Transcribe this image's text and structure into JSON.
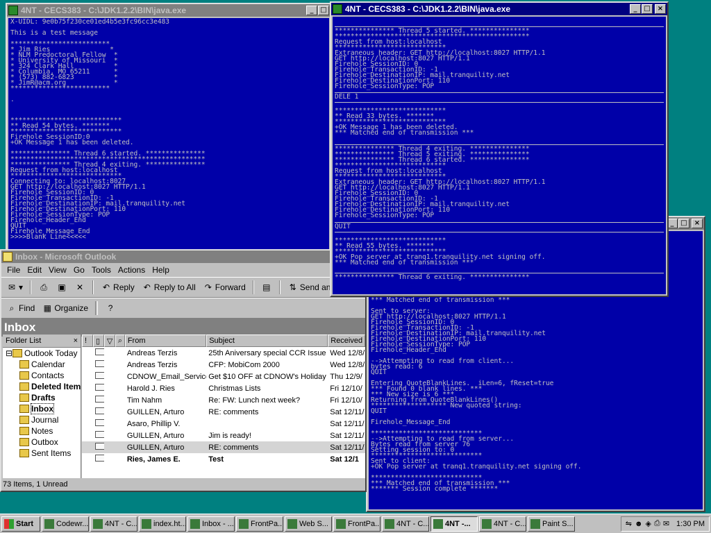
{
  "windows": {
    "console_left": {
      "title": "4NT - CECS383 - C:\\JDK1.2.2\\BIN\\java.exe",
      "lines_top": "X-UIDL: 9e0b75f230ce01ed4b5e3fc96cc3e483\n\nThis is a test message\n\n*************************\n* Jim Ries               *\n* NLM Predoctoral Fellow  *\n* University of Missouri  *\n* 324 Clark Hall          *\n* Columbia, MO 65211      *\n* (573) 882-6823          *\n* JimR@acm.org            *\n*************************\n\n.",
      "lines_bottom": "****************************\n** Read 54 bytes. *******\n****************************\nFirehole_SessionID:0\n+OK Message 1 has been deleted.\n\n*************** Thread 6 started. ***************\n*************************************************\n*************** Thread 4 exiting. ***************\nRequest from host:localhost\n****************************\nConnecting to: localhost:8027\nGET http://localhost:8027 HTTP/1.1\nFirehole_SessionID: 0\nFirehole_TransactionID: -1\nFirehole_DestinationIP: mail.tranquility.net\nFirehole_DestinationPort: 110\nFirehole_SessionType: POP\nFirehole_Header_End\nQUIT\nFirehole_Message_End\n>>>>Blank Line<<<<<"
    },
    "console_right": {
      "title": "4NT - CECS383 - C:\\JDK1.2.2\\BIN\\java.exe",
      "block1": "*************** Thread 5 started. ***************\n*************************************************\nRequest from host:localhost\n****************************\nExtraneous header: GET http://localhost:8027 HTTP/1.1\nGET http://localhost:8027 HTTP/1.1\nFirehole_SessionID: 0\nFirehole_TransactionID: -1\nFirehole_DestinationIP: mail.tranquility.net\nFirehole_DestinationPort: 110\nFirehole_SessionType: POP",
      "block2": "DELE 1",
      "block3": "****************************\n** Read 33 bytes. *******\n****************************\n+OK Message 1 has been deleted.\n*** Matched end of transmission ***",
      "block4": "*************** Thread 4 exiting. ***************\n*************** Thread 5 exiting. ***************\n*************** Thread 6 started. ***************\n****************************\nRequest from host:localhost\n****************************\nExtraneous header: GET http://localhost:8027 HTTP/1.1\nGET http://localhost:8027 HTTP/1.1\nFirehole_SessionID: 0\nFirehole_TransactionID: -1\nFirehole_DestinationIP: mail.tranquility.net\nFirehole_DestinationPort: 110\nFirehole_SessionType: POP",
      "block5": "QUIT",
      "block6": "****************************\n** Read 55 bytes. *******\n****************************\n+OK Pop server at tranq1.tranquility.net signing off.\n*** Matched end of transmission ***",
      "block7": "*************** Thread 6 exiting. ***************"
    },
    "console_back": {
      "lines": "*** Matched end of transmission ***\n\nSent to server:\nGET http://localhost:8027 HTTP/1.1\nFirehole_SessionID: 0\nFirehole_TransactionID: -1\nFirehole_DestinationIP: mail.tranquility.net\nFirehole_DestinationPort: 110\nFirehole_SessionType: POP\nFirehole_Header_End\n\n-->Attempting to read from client...\nbytes read: 6\nQUIT\n\nEntering QuoteBlankLines.  iLen=6, fReset=true\n*** Found 0 blank lines. ***\n*** New size is 6 ***\nReturning from QuoteBlankLines()\n******************* New quoted string:\nQUIT\n\nFirehole_Message_End\n\n****************************\n-->Attempting to read from server...\nBytes read from server 76\nSetting session to: 0\n****************************\nSent to client:\n+OK Pop server at tranq1.tranquility.net signing off.\n\n****************************\n*** Matched end of transmission ***\n******* Session complete *******"
    }
  },
  "outlook": {
    "title": "Inbox - Microsoft Outlook",
    "menu": [
      "File",
      "Edit",
      "View",
      "Go",
      "Tools",
      "Actions",
      "Help"
    ],
    "toolbar1": {
      "reply": "Reply",
      "reply_all": "Reply to All",
      "forward": "Forward",
      "send_receive": "Send and Receive"
    },
    "toolbar2": {
      "find": "Find",
      "organize": "Organize"
    },
    "inbox_label": "Inbox",
    "folder_list_label": "Folder List",
    "folders": [
      {
        "name": "Outlook Today"
      },
      {
        "name": "Calendar"
      },
      {
        "name": "Contacts"
      },
      {
        "name": "Deleted Items"
      },
      {
        "name": "Drafts"
      },
      {
        "name": "Inbox"
      },
      {
        "name": "Journal"
      },
      {
        "name": "Notes"
      },
      {
        "name": "Outbox"
      },
      {
        "name": "Sent Items"
      }
    ],
    "columns": {
      "from": "From",
      "subject": "Subject",
      "received": "Received"
    },
    "messages": [
      {
        "from": "Andreas Terzis",
        "subject": "25th Aniversary special CCR Issue",
        "received": "Wed 12/8/"
      },
      {
        "from": "Andreas Terzis",
        "subject": "CFP: MobiCom 2000",
        "received": "Wed 12/8/"
      },
      {
        "from": "CDNOW_Email_Service",
        "subject": "Get $10 OFF at CDNOW's Holiday",
        "received": "Thu 12/9/"
      },
      {
        "from": "Harold J. Ries",
        "subject": "Christmas Lists",
        "received": "Fri 12/10/"
      },
      {
        "from": "Tim Nahm",
        "subject": "Re: FW: Lunch next week?",
        "received": "Fri 12/10/"
      },
      {
        "from": "GUILLEN, Arturo",
        "subject": "RE: comments",
        "received": "Sat 12/11/"
      },
      {
        "from": "Asaro, Phillip V.",
        "subject": "",
        "received": "Sat 12/11/"
      },
      {
        "from": "GUILLEN, Arturo",
        "subject": "Jim is ready!",
        "received": "Sat 12/11/"
      },
      {
        "from": "GUILLEN, Arturo",
        "subject": "RE: comments",
        "received": "Sat 12/11/"
      },
      {
        "from": "Ries, James E.",
        "subject": "Test",
        "received": "Sat 12/1"
      }
    ],
    "status": "73 Items, 1 Unread"
  },
  "taskbar": {
    "start": "Start",
    "buttons": [
      "Codewr...",
      "4NT - C...",
      "index.ht...",
      "Inbox - ...",
      "FrontPa...",
      "Web S...",
      "FrontPa...",
      "4NT - C...",
      "4NT -...",
      "4NT - C...",
      "Paint S..."
    ],
    "clock": "1:30 PM"
  }
}
